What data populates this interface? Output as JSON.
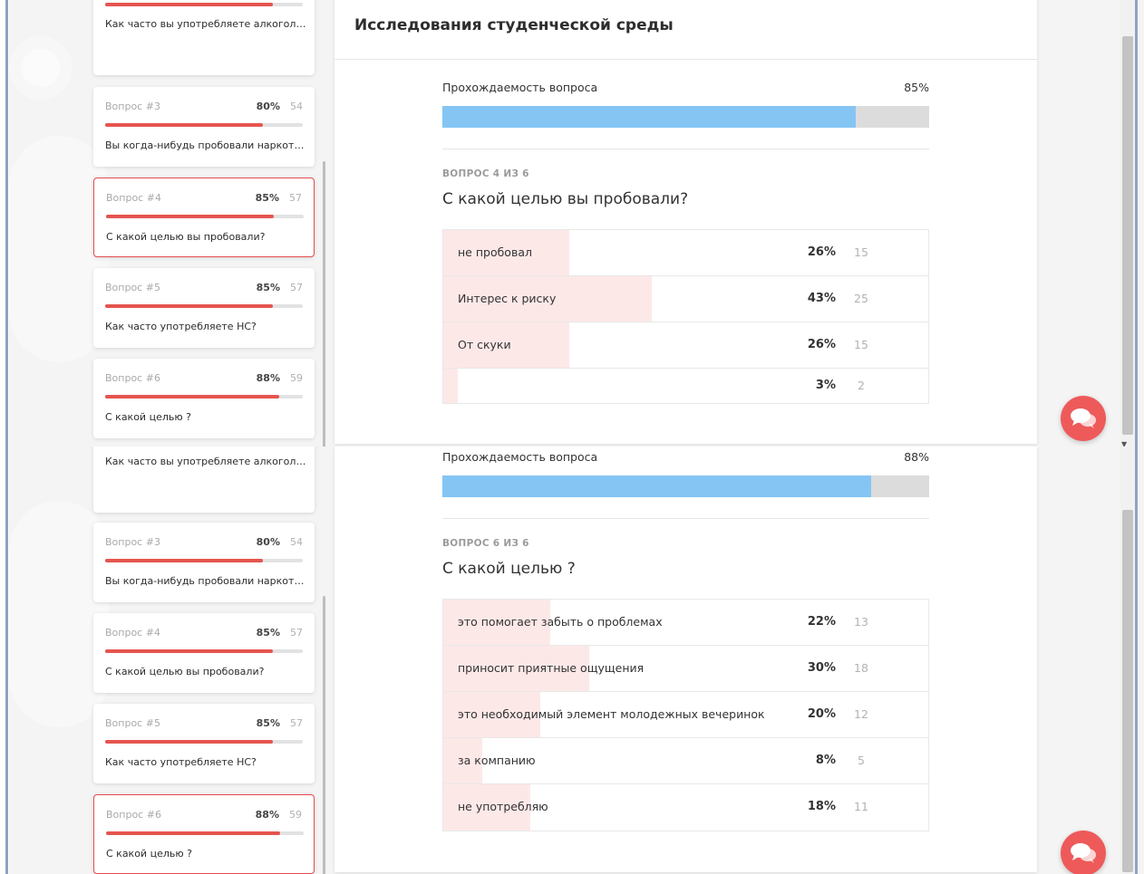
{
  "header": {
    "title": "Исследования студенческой среды"
  },
  "sidebar_top": [
    {
      "num": "",
      "pct": "",
      "count": "",
      "fill": 85,
      "text": "Как часто вы употребляете алкоголь?",
      "active": false,
      "cut": true
    },
    {
      "num": "Вопрос #3",
      "pct": "80%",
      "count": "54",
      "fill": 80,
      "text": "Вы когда-нибудь пробовали наркотики?",
      "active": false,
      "cut": false
    },
    {
      "num": "Вопрос #4",
      "pct": "85%",
      "count": "57",
      "fill": 85,
      "text": "С какой целью вы пробовали?",
      "active": true,
      "cut": false
    },
    {
      "num": "Вопрос #5",
      "pct": "85%",
      "count": "57",
      "fill": 85,
      "text": "Как часто употребляете НС?",
      "active": false,
      "cut": false
    },
    {
      "num": "Вопрос #6",
      "pct": "88%",
      "count": "59",
      "fill": 88,
      "text": "С какой целью ?",
      "active": false,
      "cut": false
    }
  ],
  "sidebar_bottom": [
    {
      "num": "",
      "pct": "",
      "count": "",
      "fill": 85,
      "text": "Как часто вы употребляете алкоголь?",
      "active": false,
      "cut": true
    },
    {
      "num": "Вопрос #3",
      "pct": "80%",
      "count": "54",
      "fill": 80,
      "text": "Вы когда-нибудь пробовали наркотики?",
      "active": false,
      "cut": false
    },
    {
      "num": "Вопрос #4",
      "pct": "85%",
      "count": "57",
      "fill": 85,
      "text": "С какой целью вы пробовали?",
      "active": false,
      "cut": false
    },
    {
      "num": "Вопрос #5",
      "pct": "85%",
      "count": "57",
      "fill": 85,
      "text": "Как часто употребляете НС?",
      "active": false,
      "cut": false
    },
    {
      "num": "Вопрос #6",
      "pct": "88%",
      "count": "59",
      "fill": 88,
      "text": "С какой целью ?",
      "active": true,
      "cut": false
    }
  ],
  "question_top": {
    "pass_label": "Прохождаемость вопроса",
    "pass_pct": "85%",
    "pass_fill": 85,
    "counter": "ВОПРОС 4 ИЗ 6",
    "title": "С какой целью вы пробовали?",
    "answers": [
      {
        "label": "не пробовал",
        "pct": "26%",
        "count": "15",
        "fill": 26
      },
      {
        "label": "Интерес к риску",
        "pct": "43%",
        "count": "25",
        "fill": 43
      },
      {
        "label": "От скуки",
        "pct": "26%",
        "count": "15",
        "fill": 26
      },
      {
        "label": "",
        "pct": "3%",
        "count": "2",
        "fill": 3
      }
    ]
  },
  "question_bottom": {
    "pass_label": "Прохождаемость вопроса",
    "pass_pct": "88%",
    "pass_fill": 88,
    "counter": "ВОПРОС 6 ИЗ 6",
    "title": "С какой целью ?",
    "answers": [
      {
        "label": "это помогает забыть о проблемах",
        "pct": "22%",
        "count": "13",
        "fill": 22
      },
      {
        "label": "приносит приятные ощущения",
        "pct": "30%",
        "count": "18",
        "fill": 30
      },
      {
        "label": "это необходимый элемент молодежных вечеринок",
        "pct": "20%",
        "count": "12",
        "fill": 20
      },
      {
        "label": "за компанию",
        "pct": "8%",
        "count": "5",
        "fill": 8
      },
      {
        "label": "не употребляю",
        "pct": "18%",
        "count": "11",
        "fill": 18
      }
    ]
  },
  "icons": {
    "chat": "chat-bubbles-icon"
  },
  "colors": {
    "accent_red": "#e5554f",
    "pass_blue": "#85c5f4",
    "answer_fill": "#fde8e8"
  }
}
